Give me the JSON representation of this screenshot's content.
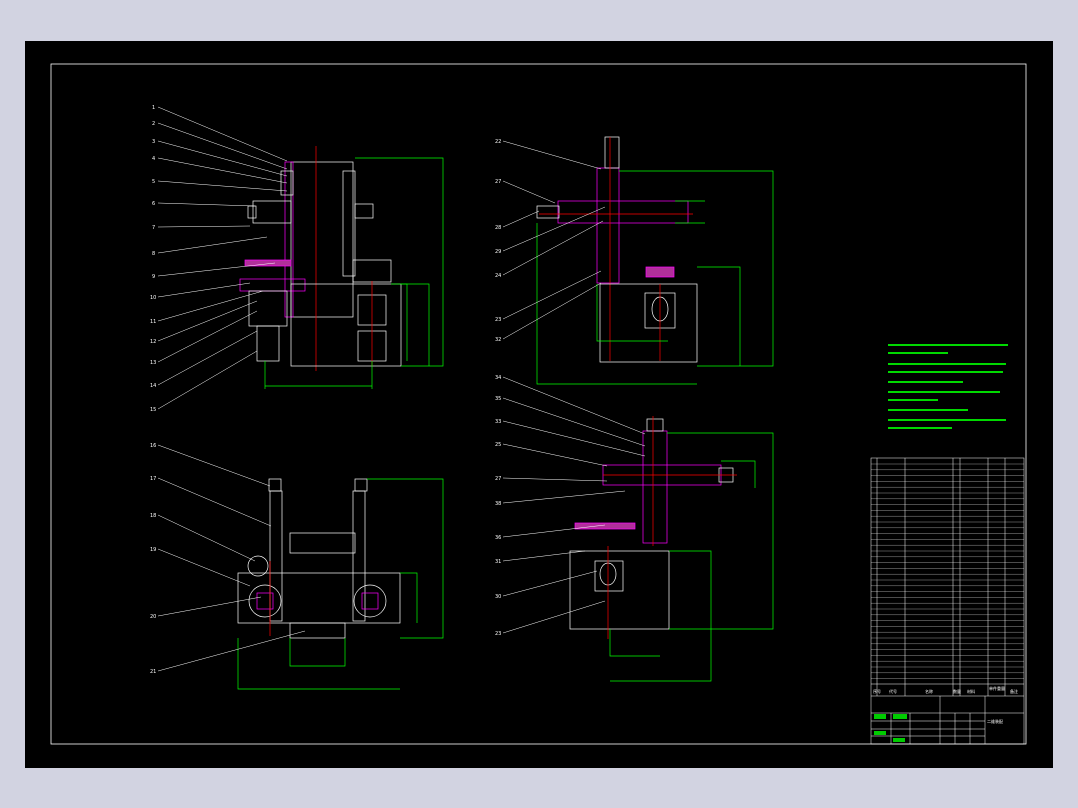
{
  "colors": {
    "background": "#d2d3e1",
    "drawing_bg": "#000000",
    "outline": "#ffffff",
    "dimension": "#00ff00",
    "centerline": "#ff0000",
    "part": "#ff00ff"
  },
  "title_block": {
    "drawing_title": "二维装配",
    "header_cells": [
      "序号",
      "代号",
      "名称",
      "数量",
      "材料",
      "单件重量",
      "备注"
    ]
  }
}
